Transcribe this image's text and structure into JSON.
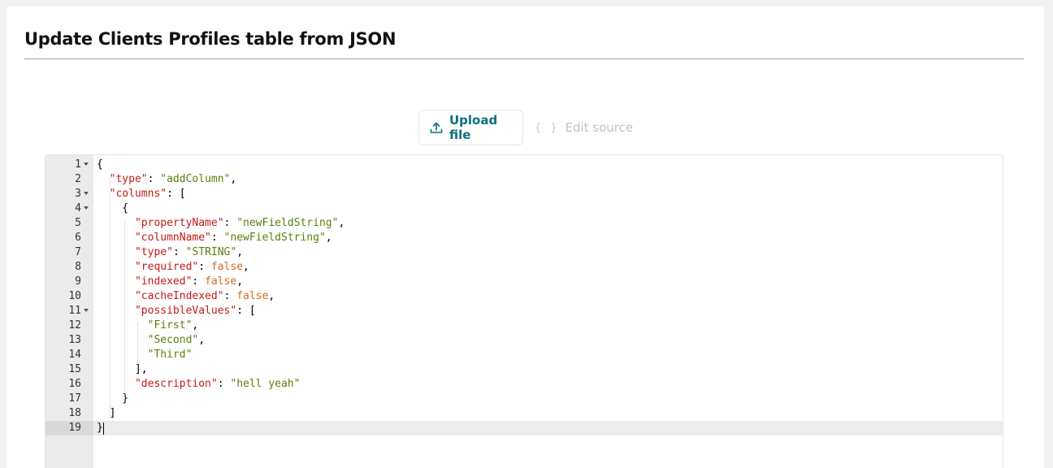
{
  "page": {
    "title": "Update Clients Profiles table from JSON"
  },
  "toggle": {
    "upload_label": "Upload file",
    "edit_label": "Edit source",
    "edit_icon_glyph": "{ }",
    "active": "upload",
    "accent_color": "#0b6f80"
  },
  "editor": {
    "lines": [
      {
        "n": "1",
        "fold": true,
        "tokens": [
          {
            "t": "p",
            "v": "{"
          }
        ]
      },
      {
        "n": "2",
        "fold": false,
        "tokens": [
          {
            "t": "p",
            "v": "  "
          },
          {
            "t": "k",
            "v": "\"type\""
          },
          {
            "t": "p",
            "v": ": "
          },
          {
            "t": "s",
            "v": "\"addColumn\""
          },
          {
            "t": "p",
            "v": ","
          }
        ]
      },
      {
        "n": "3",
        "fold": true,
        "tokens": [
          {
            "t": "p",
            "v": "  "
          },
          {
            "t": "k",
            "v": "\"columns\""
          },
          {
            "t": "p",
            "v": ": ["
          }
        ]
      },
      {
        "n": "4",
        "fold": true,
        "tokens": [
          {
            "t": "p",
            "v": "    {"
          }
        ]
      },
      {
        "n": "5",
        "fold": false,
        "tokens": [
          {
            "t": "p",
            "v": "      "
          },
          {
            "t": "k",
            "v": "\"propertyName\""
          },
          {
            "t": "p",
            "v": ": "
          },
          {
            "t": "s",
            "v": "\"newFieldString\""
          },
          {
            "t": "p",
            "v": ","
          }
        ]
      },
      {
        "n": "6",
        "fold": false,
        "tokens": [
          {
            "t": "p",
            "v": "      "
          },
          {
            "t": "k",
            "v": "\"columnName\""
          },
          {
            "t": "p",
            "v": ": "
          },
          {
            "t": "s",
            "v": "\"newFieldString\""
          },
          {
            "t": "p",
            "v": ","
          }
        ]
      },
      {
        "n": "7",
        "fold": false,
        "tokens": [
          {
            "t": "p",
            "v": "      "
          },
          {
            "t": "k",
            "v": "\"type\""
          },
          {
            "t": "p",
            "v": ": "
          },
          {
            "t": "s",
            "v": "\"STRING\""
          },
          {
            "t": "p",
            "v": ","
          }
        ]
      },
      {
        "n": "8",
        "fold": false,
        "tokens": [
          {
            "t": "p",
            "v": "      "
          },
          {
            "t": "k",
            "v": "\"required\""
          },
          {
            "t": "p",
            "v": ": "
          },
          {
            "t": "b",
            "v": "false"
          },
          {
            "t": "p",
            "v": ","
          }
        ]
      },
      {
        "n": "9",
        "fold": false,
        "tokens": [
          {
            "t": "p",
            "v": "      "
          },
          {
            "t": "k",
            "v": "\"indexed\""
          },
          {
            "t": "p",
            "v": ": "
          },
          {
            "t": "b",
            "v": "false"
          },
          {
            "t": "p",
            "v": ","
          }
        ]
      },
      {
        "n": "10",
        "fold": false,
        "tokens": [
          {
            "t": "p",
            "v": "      "
          },
          {
            "t": "k",
            "v": "\"cacheIndexed\""
          },
          {
            "t": "p",
            "v": ": "
          },
          {
            "t": "b",
            "v": "false"
          },
          {
            "t": "p",
            "v": ","
          }
        ]
      },
      {
        "n": "11",
        "fold": true,
        "tokens": [
          {
            "t": "p",
            "v": "      "
          },
          {
            "t": "k",
            "v": "\"possibleValues\""
          },
          {
            "t": "p",
            "v": ": ["
          }
        ]
      },
      {
        "n": "12",
        "fold": false,
        "tokens": [
          {
            "t": "p",
            "v": "        "
          },
          {
            "t": "s",
            "v": "\"First\""
          },
          {
            "t": "p",
            "v": ","
          }
        ]
      },
      {
        "n": "13",
        "fold": false,
        "tokens": [
          {
            "t": "p",
            "v": "        "
          },
          {
            "t": "s",
            "v": "\"Second\""
          },
          {
            "t": "p",
            "v": ","
          }
        ]
      },
      {
        "n": "14",
        "fold": false,
        "tokens": [
          {
            "t": "p",
            "v": "        "
          },
          {
            "t": "s",
            "v": "\"Third\""
          }
        ]
      },
      {
        "n": "15",
        "fold": false,
        "tokens": [
          {
            "t": "p",
            "v": "      ],"
          }
        ]
      },
      {
        "n": "16",
        "fold": false,
        "tokens": [
          {
            "t": "p",
            "v": "      "
          },
          {
            "t": "k",
            "v": "\"description\""
          },
          {
            "t": "p",
            "v": ": "
          },
          {
            "t": "s",
            "v": "\"hell yeah\""
          }
        ]
      },
      {
        "n": "17",
        "fold": false,
        "tokens": [
          {
            "t": "p",
            "v": "    }"
          }
        ]
      },
      {
        "n": "18",
        "fold": false,
        "tokens": [
          {
            "t": "p",
            "v": "  ]"
          }
        ]
      },
      {
        "n": "19",
        "fold": false,
        "tokens": [
          {
            "t": "p",
            "v": "}"
          }
        ],
        "active": true
      }
    ]
  }
}
